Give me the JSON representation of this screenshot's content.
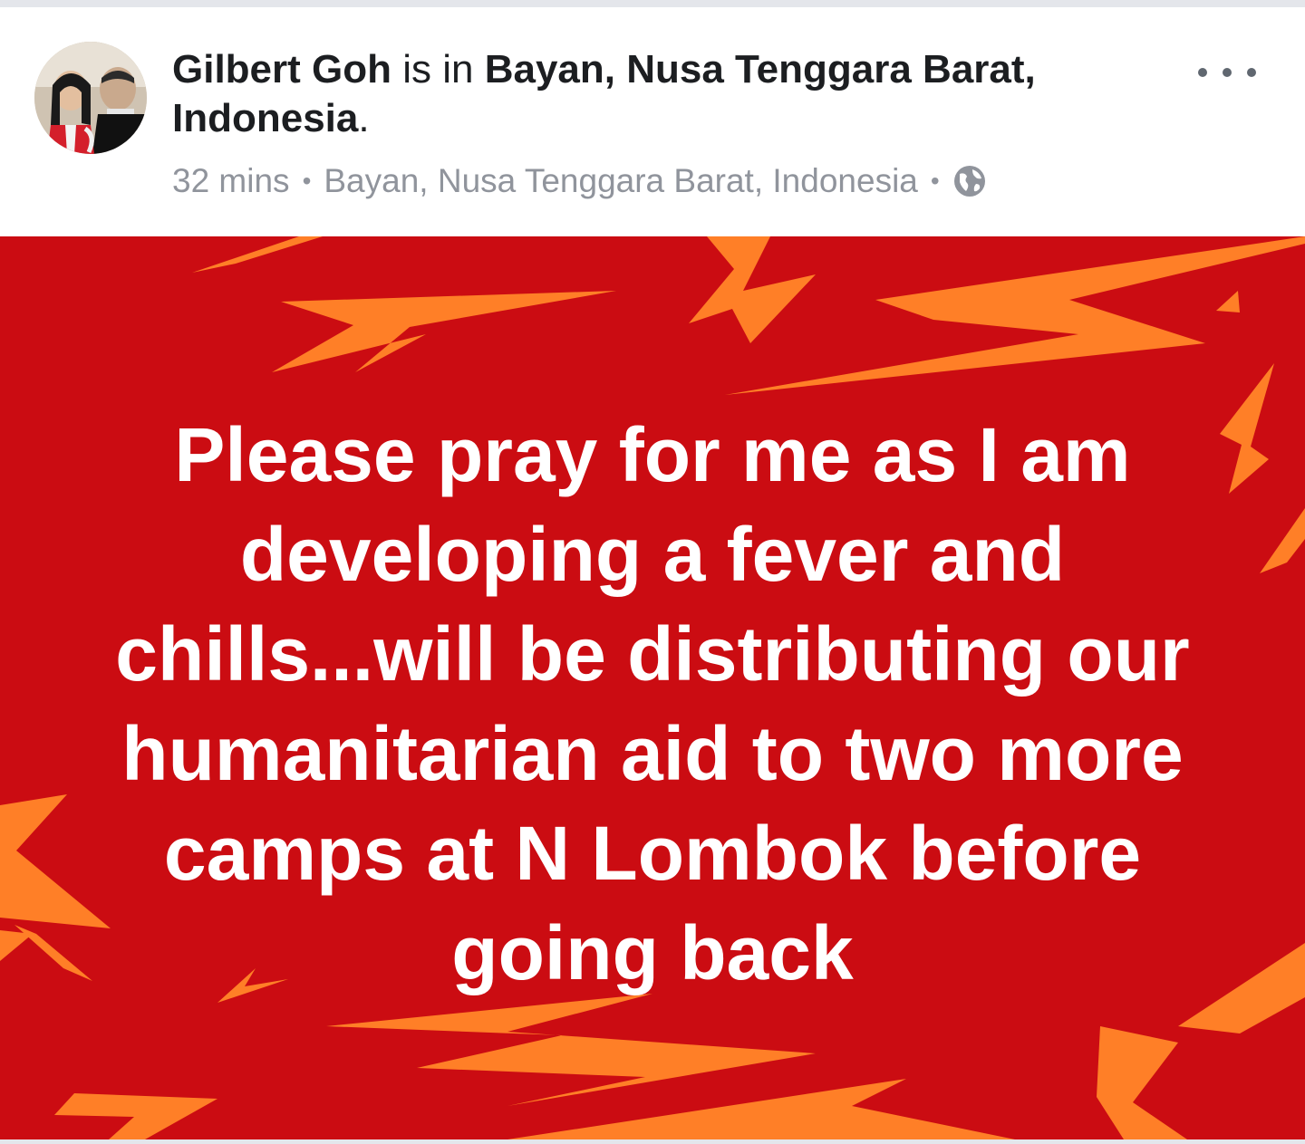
{
  "post": {
    "author_name": "Gilbert Goh",
    "is_in_text": " is in ",
    "place_name": "Bayan, Nusa Tenggara Barat, Indonesia",
    "period": ".",
    "timestamp": "32 mins",
    "location": "Bayan, Nusa Tenggara Barat, Indonesia",
    "separator": "•",
    "privacy_icon": "globe-icon",
    "more_icon": "more-options-icon",
    "body_text": "Please pray for me as I am\ndeveloping a fever and\nchills...will be distributing our\nhumanitarian aid to two more\ncamps at N Lombok before\ngoing back"
  },
  "colors": {
    "background_red": "#cb0c12",
    "bolt_orange": "#ff7f27",
    "text_white": "#ffffff",
    "meta_gray": "#90949c",
    "name_black": "#1c1e21"
  }
}
